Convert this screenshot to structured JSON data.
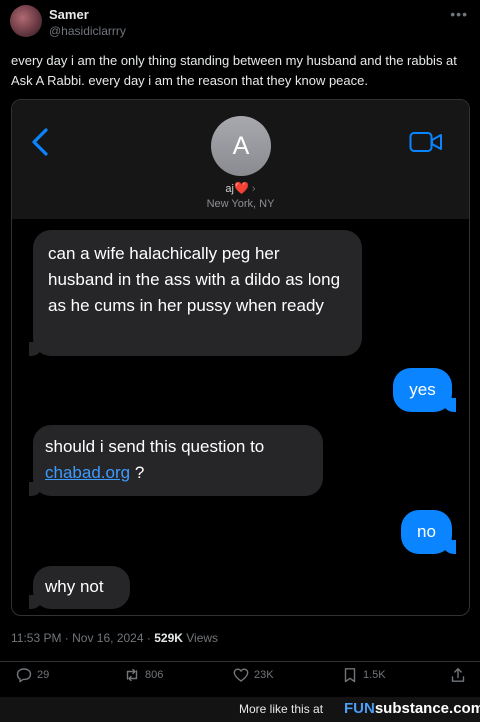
{
  "tweet": {
    "author_name": "Samer",
    "author_handle": "@hasidiclarrry",
    "text": "every day i am the only thing standing between my husband and the rabbis at Ask A Rabbi. every day i am the reason that they know peace.",
    "timestamp": "11:53 PM · Nov 16, 2024",
    "views_count": "529K",
    "views_label": "Views",
    "replies": "29",
    "reposts": "806",
    "likes": "23K",
    "bookmarks": "1.5K"
  },
  "conversation": {
    "contact_initial": "A",
    "contact_name": "aj",
    "contact_heart": "❤️",
    "contact_location": "New York, NY",
    "messages": [
      {
        "from": "them",
        "text": "can a wife halachically peg her husband in the ass with a dildo as long as he cums in her pussy when ready"
      },
      {
        "from": "me",
        "text": "yes"
      },
      {
        "from": "them",
        "text_before": "should i send this question to",
        "link": "chabad.org",
        "text_after": "?"
      },
      {
        "from": "me",
        "text": "no"
      },
      {
        "from": "them",
        "text": "why not"
      }
    ]
  },
  "watermark": {
    "text": "More like this at",
    "brand_fun": "FUN",
    "brand_rest": "substance.com"
  },
  "colors": {
    "bubble_blue": "#0a84ff",
    "bubble_gray": "#262628",
    "link_blue": "#3d9bff",
    "heart_red": "#e5332a"
  }
}
